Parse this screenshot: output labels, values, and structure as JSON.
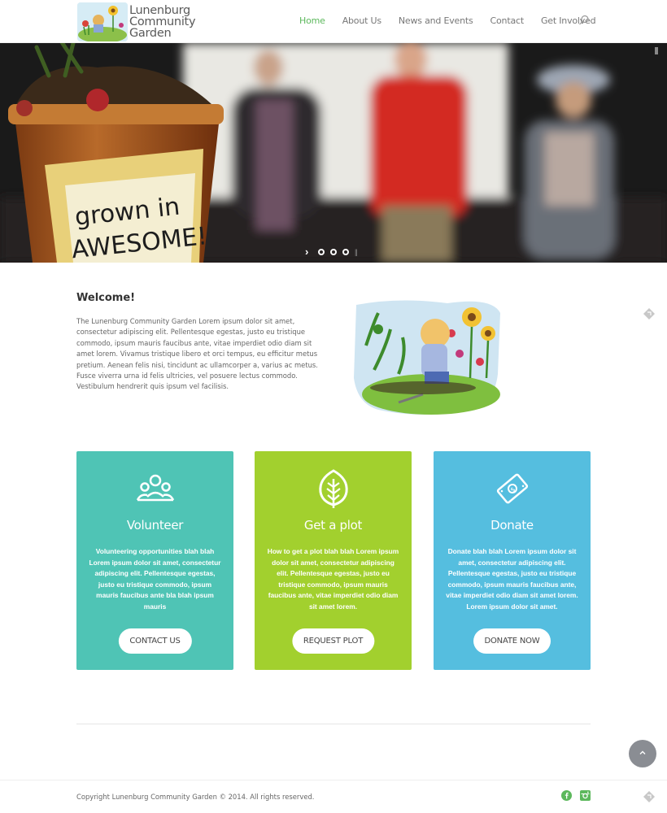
{
  "site": {
    "logo_lines": [
      "Lunenburg",
      "Community",
      "Garden"
    ]
  },
  "nav": {
    "items": [
      {
        "label": "Home",
        "active": true
      },
      {
        "label": "About Us"
      },
      {
        "label": "News and Events"
      },
      {
        "label": "Contact"
      },
      {
        "label": "Get Involved"
      }
    ],
    "search_icon": "search-icon"
  },
  "hero": {
    "sign_line1": "grown in",
    "sign_line2": "AWESOME!",
    "slides": 3,
    "active_slide": 1
  },
  "welcome": {
    "title": "Welcome!",
    "body": "The Lunenburg Community Garden Lorem ipsum dolor sit amet, consectetur adipiscing elit. Pellentesque egestas, justo eu tristique commodo, ipsum mauris faucibus ante, vitae imperdiet odio diam sit amet lorem. Vivamus tristique libero et orci tempus, eu efficitur metus pretium. Aenean felis nisi, tincidunt ac ullamcorper a, varius ac metus. Fusce viverra urna id felis ultricies, vel posuere lectus commodo. Vestibulum hendrerit quis ipsum vel facilisis."
  },
  "cards": [
    {
      "icon": "people-icon",
      "title": "Volunteer",
      "body": "Volunteering opportunities blah blah Lorem ipsum dolor sit amet, consectetur adipiscing elit. Pellentesque egestas, justo eu tristique commodo, ipsum mauris faucibus ante bla blah ipsum mauris",
      "button": "CONTACT US",
      "color": "#4fc4b5"
    },
    {
      "icon": "leaf-icon",
      "title": "Get a plot",
      "body": "How to get a plot blah blah Lorem ipsum dolor sit amet, consectetur adipiscing elit. Pellentesque egestas, justo eu tristique commodo, ipsum mauris faucibus ante, vitae imperdiet odio diam sit amet lorem.",
      "button": "REQUEST PLOT",
      "color": "#a2d02e"
    },
    {
      "icon": "money-icon",
      "title": "Donate",
      "body": "Donate blah blah Lorem ipsum dolor sit amet, consectetur adipiscing elit. Pellentesque egestas, justo eu tristique commodo, ipsum mauris faucibus ante, vitae imperdiet odio diam sit amet lorem. Lorem ipsum dolor sit amet.",
      "button": "DONATE NOW",
      "color": "#55bedf"
    }
  ],
  "footer": {
    "copyright": "Copyright Lunenburg Community Garden © 2014. All rights reserved.",
    "social": [
      "facebook-icon",
      "instagram-icon"
    ],
    "social_color": "#5cb85c"
  },
  "back_to_top_icon": "chevron-up-icon"
}
